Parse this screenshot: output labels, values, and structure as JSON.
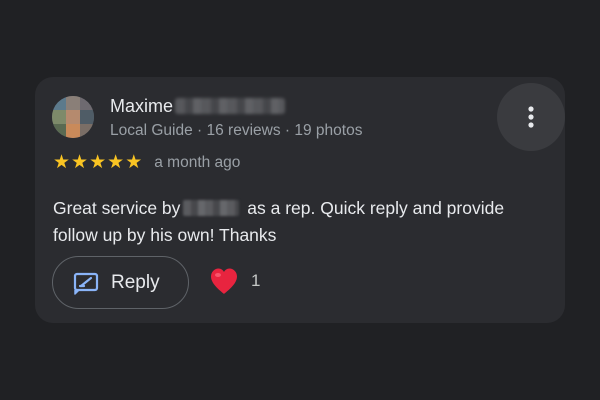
{
  "review": {
    "author": {
      "first_name": "Maxime",
      "meta": "Local Guide · 16 reviews · 19 photos"
    },
    "rating": {
      "value": 5,
      "max": 5,
      "star_char": "★"
    },
    "time": "a month ago",
    "text_before": "Great service by",
    "text_after": " as a rep. Quick reply and provide follow up by his own! Thanks",
    "actions": {
      "reply_label": "Reply",
      "heart_count": "1"
    },
    "icons": {
      "more": "more-vertical-icon",
      "reply": "reply-edit-icon",
      "heart": "heart-icon"
    },
    "colors": {
      "background": "#202124",
      "card": "#2b2c30",
      "star": "#f9c423",
      "reply_icon": "#8ab4f8",
      "heart": "#e8243f"
    }
  }
}
